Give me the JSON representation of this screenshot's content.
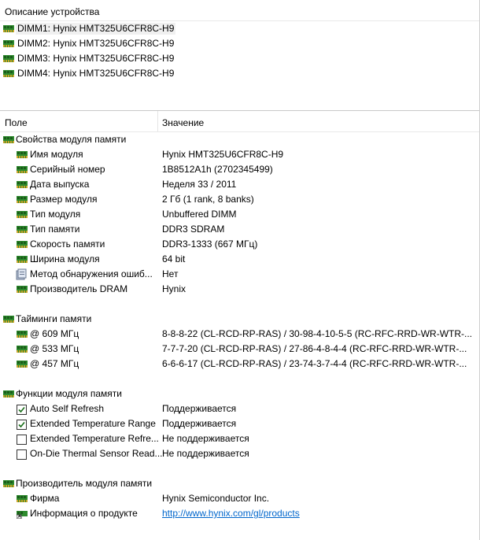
{
  "device_pane": {
    "header": "Описание устройства",
    "devices": [
      {
        "label": "DIMM1: Hynix HMT325U6CFR8C-H9",
        "selected": true
      },
      {
        "label": "DIMM2: Hynix HMT325U6CFR8C-H9",
        "selected": false
      },
      {
        "label": "DIMM3: Hynix HMT325U6CFR8C-H9",
        "selected": false
      },
      {
        "label": "DIMM4: Hynix HMT325U6CFR8C-H9",
        "selected": false
      }
    ]
  },
  "columns": {
    "field": "Поле",
    "value": "Значение"
  },
  "sections": {
    "module_props": {
      "title": "Свойства модуля памяти",
      "rows": [
        {
          "field": "Имя модуля",
          "value": "Hynix HMT325U6CFR8C-H9",
          "icon": "ram-icon"
        },
        {
          "field": "Серийный номер",
          "value": "1B8512A1h (2702345499)",
          "icon": "ram-icon"
        },
        {
          "field": "Дата выпуска",
          "value": "Неделя 33 / 2011",
          "icon": "ram-icon"
        },
        {
          "field": "Размер модуля",
          "value": "2 Гб (1 rank, 8 banks)",
          "icon": "ram-icon"
        },
        {
          "field": "Тип модуля",
          "value": "Unbuffered DIMM",
          "icon": "ram-icon"
        },
        {
          "field": "Тип памяти",
          "value": "DDR3 SDRAM",
          "icon": "ram-icon"
        },
        {
          "field": "Скорость памяти",
          "value": "DDR3-1333 (667 МГц)",
          "icon": "ram-icon"
        },
        {
          "field": "Ширина модуля",
          "value": "64 bit",
          "icon": "ram-icon"
        },
        {
          "field": "Метод обнаружения ошиб...",
          "value": "Нет",
          "icon": "error-detect-icon"
        },
        {
          "field": "Производитель DRAM",
          "value": "Hynix",
          "icon": "ram-icon"
        }
      ]
    },
    "timings": {
      "title": "Тайминги памяти",
      "rows": [
        {
          "field": "@ 609 МГц",
          "value": "8-8-8-22  (CL-RCD-RP-RAS) / 30-98-4-10-5-5  (RC-RFC-RRD-WR-WTR-..."
        },
        {
          "field": "@ 533 МГц",
          "value": "7-7-7-20  (CL-RCD-RP-RAS) / 27-86-4-8-4-4  (RC-RFC-RRD-WR-WTR-..."
        },
        {
          "field": "@ 457 МГц",
          "value": "6-6-6-17  (CL-RCD-RP-RAS) / 23-74-3-7-4-4  (RC-RFC-RRD-WR-WTR-..."
        }
      ]
    },
    "functions": {
      "title": "Функции модуля памяти",
      "rows": [
        {
          "field": "Auto Self Refresh",
          "value": "Поддерживается",
          "checked": true
        },
        {
          "field": "Extended Temperature Range",
          "value": "Поддерживается",
          "checked": true
        },
        {
          "field": "Extended Temperature Refre...",
          "value": "Не поддерживается",
          "checked": false
        },
        {
          "field": "On-Die Thermal Sensor Read...",
          "value": "Не поддерживается",
          "checked": false
        }
      ]
    },
    "manufacturer": {
      "title": "Производитель модуля памяти",
      "rows": [
        {
          "field": "Фирма",
          "value": "Hynix Semiconductor Inc.",
          "icon": "ram-icon"
        },
        {
          "field": "Информация о продукте",
          "value": "http://www.hynix.com/gl/products",
          "icon": "link-icon"
        }
      ]
    }
  },
  "colors": {
    "ram_icon_green": "#2e8b2e",
    "link": "#0066cc",
    "selection": "#f0f0f0"
  }
}
